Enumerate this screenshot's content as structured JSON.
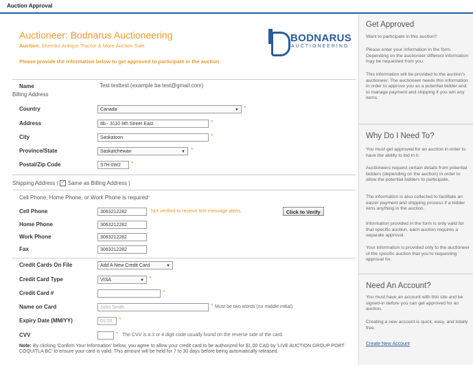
{
  "window": {
    "title": "Auction Approval"
  },
  "header": {
    "auctioneer": "Auctioneer: Bodnarus Auctioneering",
    "auction_label": "Auction:",
    "auction_name": "Shemko Antique Tractor & More Auction Sale",
    "logo_brand": "BODNARUS",
    "logo_sub": "AUCTIONEERING",
    "instructions": "Please provide the information below to get approved to participate in the auction."
  },
  "name": {
    "label": "Name",
    "value": "Test testtest (example ba test@gmail.com)"
  },
  "billing": {
    "heading": "Billing Address",
    "country_label": "Country",
    "country_value": "Canada",
    "address_label": "Address",
    "address_value": "8b - 3110 8th Street East",
    "city_label": "City",
    "city_value": "Saskatoon",
    "province_label": "Province/State",
    "province_value": "Saskatchewan",
    "postal_label": "Postal/Zip Code",
    "postal_value": "S7H 0W2"
  },
  "shipping": {
    "text": "Shipping Address (",
    "check_label": "Same as Billing Address )",
    "checked": true
  },
  "phones": {
    "requirement": "Cell Phone, Home Phone, or Work Phone is required",
    "cell_label": "Cell Phone",
    "cell_value": "3063212282",
    "not_verified": "Not verified to receive text message alerts.",
    "verify_button": "Click to Verify",
    "home_label": "Home Phone",
    "home_value": "3063212282",
    "work_label": "Work Phone",
    "work_value": "3063212282",
    "fax_label": "Fax",
    "fax_value": "3063212282"
  },
  "card": {
    "on_file_label": "Credit Cards On File",
    "on_file_value": "Add A New Credit Card",
    "type_label": "Credit Card Type",
    "type_value": "VISA",
    "number_label": "Credit Card #",
    "number_value": "",
    "name_label": "Name on Card",
    "name_placeholder": "John Smith",
    "name_note": "Must be two words (no middle initial)",
    "expiry_label": "Expiry Date (MM/YY)",
    "expiry_placeholder": "01/20",
    "cvv_label": "CVV",
    "cvv_note": "The CVV is a 3 or 4 digit code usually found on the reverse side of the card."
  },
  "legal": {
    "note_label": "Note:",
    "text": "By clicking 'Confirm Your Information' below, you agree to allow your credit card to be authorized for $1.00 CAD by 'LIVE AUCTION GROUP PORT COQUITLA BC' to ensure your card is valid. This amount will be held for 7 to 30 days before being automatically released."
  },
  "sidebar": {
    "approved_title": "Get Approved",
    "approved_p1": "Want to participate in this auction?",
    "approved_p2": "Please enter your information in the form. Depending on the auctioneer different information may be requested from you.",
    "approved_p3": "This information will be provided to the auction's auctioneer. The auctioneer needs this information in order to approve you as a potential bidder and to manage payment and shipping if you win any items.",
    "why_title": "Why Do I Need To?",
    "why_p1": "You must get approved for an auction in order to have the ability to bid in it.",
    "why_p2": "Auctioneers request certain details from potential bidders (depending on the auction) in order to allow the potential bidders to participate.",
    "why_p3": "The information is also collected to facilitate an easier payment and shipping process if a bidder wins anything in the auction.",
    "why_p4": "Information provided in the form is only valid for that specific auction, each auction requires a separate approval.",
    "why_p5": "Your information is provided only to the auctioneer of the specific auction that you're requesting approval for.",
    "account_title": "Need An Account?",
    "account_p1": "You must have an account with this site and be signed-in before you can get approved for an auction.",
    "account_p2": "Creating a new account is quick, easy, and totally free.",
    "account_link": "Create New Account"
  },
  "colors": {
    "accent": "#e89a2c",
    "brand": "#2c5b9a",
    "topbar_border": "#1d5fa5"
  }
}
